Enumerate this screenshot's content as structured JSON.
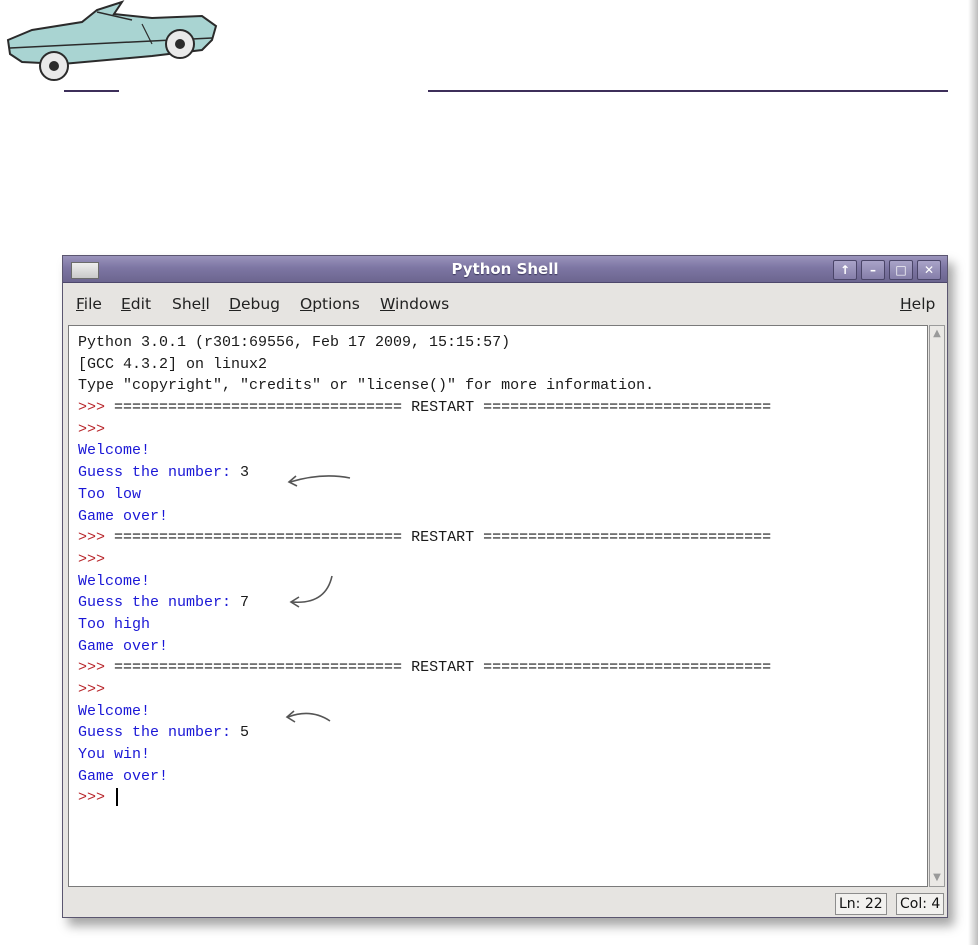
{
  "window": {
    "title": "Python Shell",
    "buttons": [
      "↑",
      "–",
      "□",
      "✕"
    ]
  },
  "menu": {
    "file": {
      "mnemonic": "F",
      "rest": "ile"
    },
    "edit": {
      "mnemonic": "E",
      "rest": "dit"
    },
    "shell": {
      "pre": "She",
      "mnemonic": "l",
      "rest": "l"
    },
    "debug": {
      "mnemonic": "D",
      "rest": "ebug"
    },
    "options": {
      "mnemonic": "O",
      "rest": "ptions"
    },
    "windows": {
      "mnemonic": "W",
      "rest": "indows"
    },
    "help": {
      "mnemonic": "H",
      "rest": "elp"
    }
  },
  "shell": {
    "lines": [
      {
        "type": "plain",
        "text": "Python 3.0.1 (r301:69556, Feb 17 2009, 15:15:57)"
      },
      {
        "type": "plain",
        "text": "[GCC 4.3.2] on linux2"
      },
      {
        "type": "plain",
        "text": "Type \"copyright\", \"credits\" or \"license()\" for more information."
      },
      {
        "type": "restart",
        "prompt": ">>> ",
        "text": "================================ RESTART ================================"
      },
      {
        "type": "prompt",
        "prompt": ">>> ",
        "text": ""
      },
      {
        "type": "out",
        "text": "Welcome!"
      },
      {
        "type": "guess",
        "text": "Guess the number: ",
        "input": "3"
      },
      {
        "type": "out",
        "text": "Too low"
      },
      {
        "type": "out",
        "text": "Game over!"
      },
      {
        "type": "restart",
        "prompt": ">>> ",
        "text": "================================ RESTART ================================"
      },
      {
        "type": "prompt",
        "prompt": ">>> ",
        "text": ""
      },
      {
        "type": "out",
        "text": "Welcome!"
      },
      {
        "type": "guess",
        "text": "Guess the number: ",
        "input": "7"
      },
      {
        "type": "out",
        "text": "Too high"
      },
      {
        "type": "out",
        "text": "Game over!"
      },
      {
        "type": "restart",
        "prompt": ">>> ",
        "text": "================================ RESTART ================================"
      },
      {
        "type": "prompt",
        "prompt": ">>> ",
        "text": ""
      },
      {
        "type": "out",
        "text": "Welcome!"
      },
      {
        "type": "guess",
        "text": "Guess the number: ",
        "input": "5"
      },
      {
        "type": "out",
        "text": "You win!"
      },
      {
        "type": "out",
        "text": "Game over!"
      },
      {
        "type": "cursor",
        "prompt": ">>> ",
        "text": ""
      }
    ]
  },
  "status": {
    "ln": "Ln: 22",
    "col": "Col: 4"
  },
  "colors": {
    "prompt": "#b8262b",
    "output": "#1a17d6",
    "titlebar": "#7d76a3"
  }
}
